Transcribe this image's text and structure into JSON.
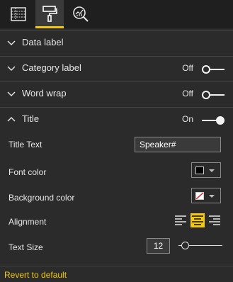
{
  "tabs": [
    {
      "icon": "fields-icon",
      "active": false
    },
    {
      "icon": "paint-roller-icon",
      "active": true
    },
    {
      "icon": "analytics-magnifier-icon",
      "active": false
    }
  ],
  "sections": {
    "data_label": {
      "title": "Data label"
    },
    "category_label": {
      "title": "Category label",
      "state": "Off"
    },
    "word_wrap": {
      "title": "Word wrap",
      "state": "Off"
    },
    "title": {
      "title": "Title",
      "state": "On"
    }
  },
  "title_props": {
    "title_text_label": "Title Text",
    "title_text_value": "Speaker#",
    "font_color_label": "Font color",
    "font_color_value": "#000000",
    "background_color_label": "Background color",
    "background_color_value": "none",
    "alignment_label": "Alignment",
    "alignment_options": [
      "left",
      "center",
      "right"
    ],
    "alignment_selected": "center",
    "text_size_label": "Text Size",
    "text_size_value": "12",
    "text_size_slider_fraction": 0.1
  },
  "footer": {
    "revert_label": "Revert to default"
  },
  "colors": {
    "accent": "#f2c811",
    "background": "#2b2b2b",
    "topbar": "#1f1f1f"
  }
}
